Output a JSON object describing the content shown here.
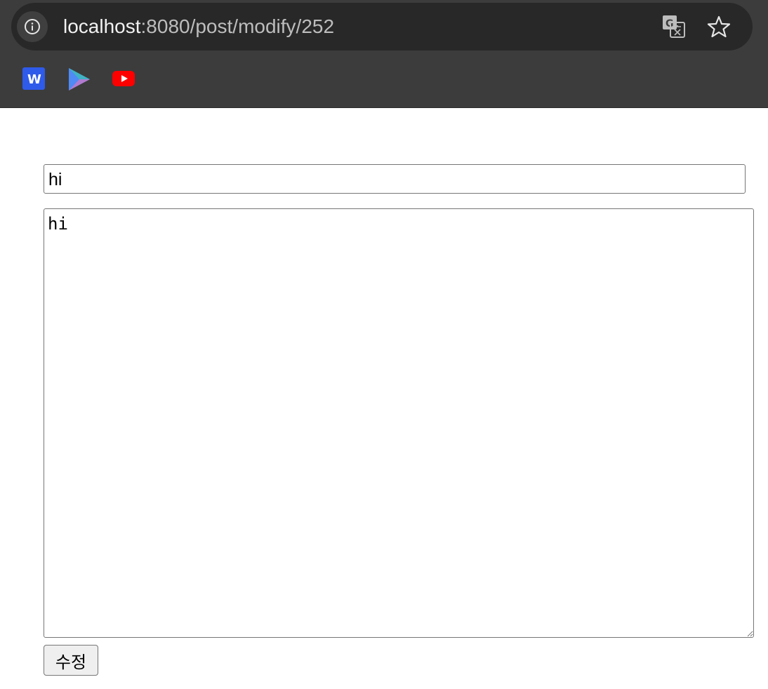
{
  "browser": {
    "url_host": "localhost",
    "url_path": ":8080/post/modify/252",
    "icons": {
      "site_info": "info-icon",
      "translate": "translate-icon",
      "bookmark_star": "star-icon"
    },
    "bookmarks": [
      {
        "icon": "w-app-icon",
        "color": "#2f5bea"
      },
      {
        "icon": "play-store-icon"
      },
      {
        "icon": "youtube-icon",
        "color": "#ff0000"
      }
    ]
  },
  "form": {
    "title_value": "hi",
    "content_value": "hi",
    "submit_label": "수정"
  }
}
